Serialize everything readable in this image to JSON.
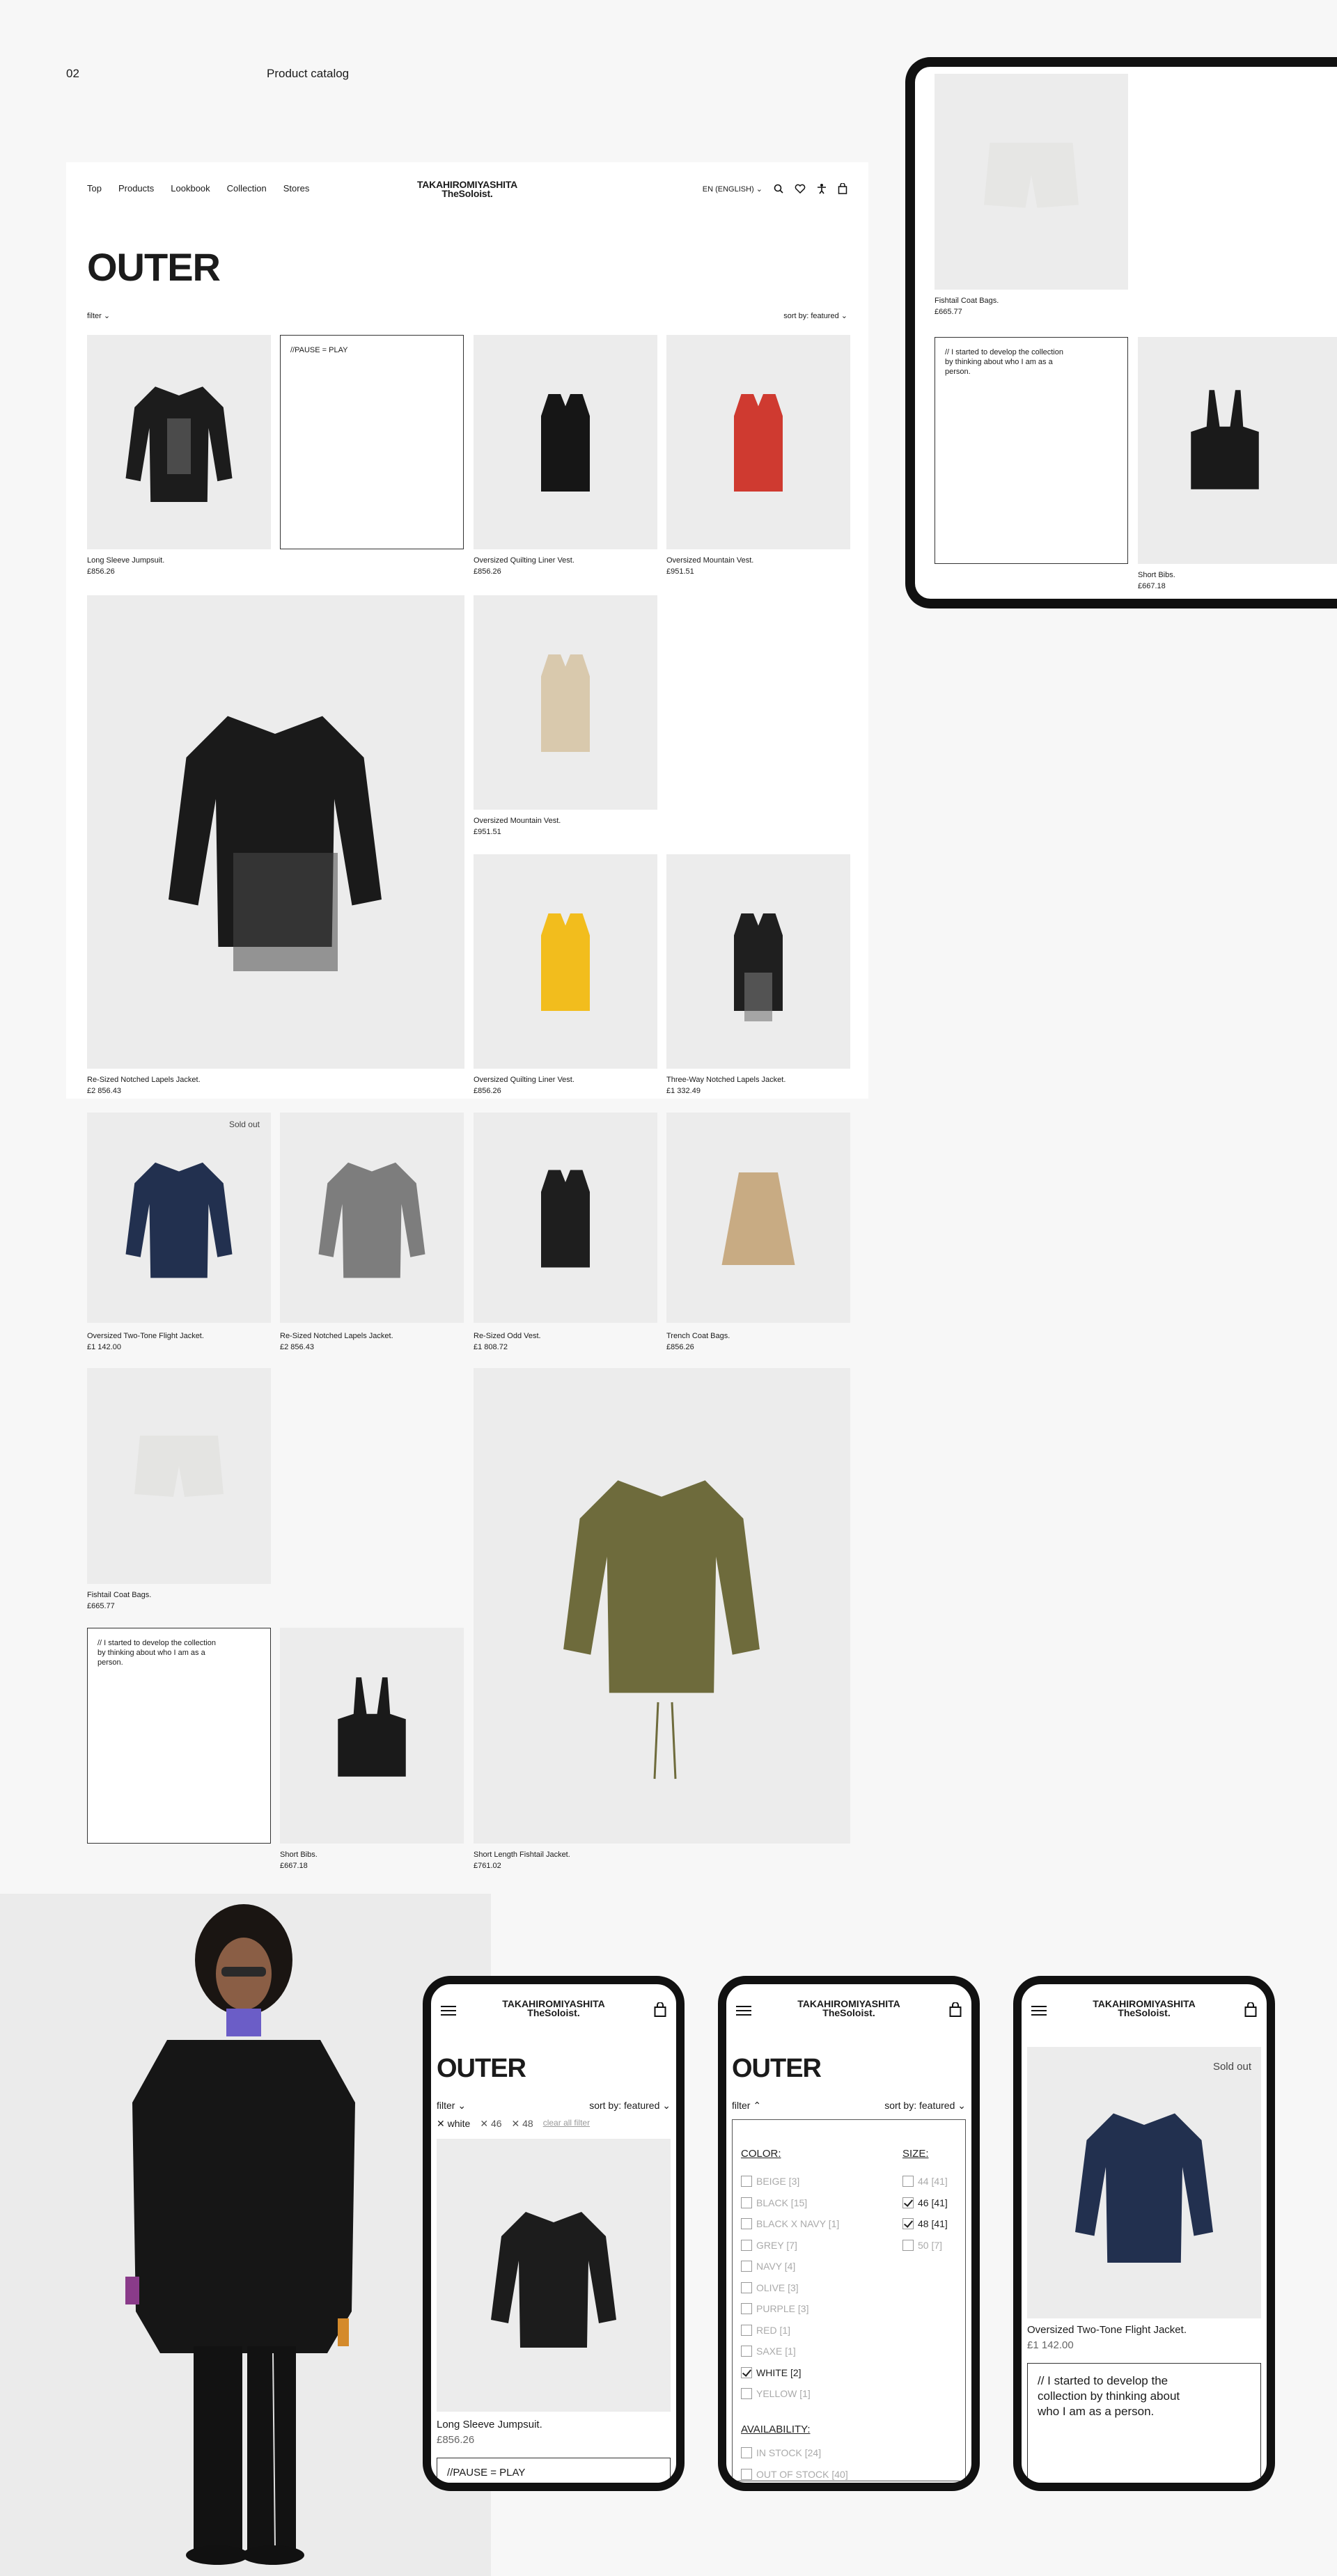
{
  "sheet": {
    "number": "02",
    "title": "Product catalog"
  },
  "nav": {
    "items": [
      "Top",
      "Products",
      "Lookbook",
      "Collection",
      "Stores"
    ],
    "language": "EN (ENGLISH)"
  },
  "brand": {
    "line1": "TAKAHIROMIYASHITA",
    "line2": "TheSoloist."
  },
  "page": {
    "heading": "OUTER",
    "filter": "filter",
    "sort": "sort by: featured"
  },
  "products": [
    {
      "name": "Long Sleeve Jumpsuit.",
      "price": "£856.26"
    },
    {
      "name": "Oversized Quilting Liner Vest.",
      "price": "£856.26"
    },
    {
      "name": "Oversized Mountain Vest.",
      "price": "£951.51"
    },
    {
      "name": "Re-Sized Notched Lapels Jacket.",
      "price": "£2 856.43"
    },
    {
      "name": "Oversized Mountain Vest.",
      "price": "£951.51"
    },
    {
      "name": "Oversized Quilting Liner Vest.",
      "price": "£856.26"
    },
    {
      "name": "Three-Way Notched Lapels Jacket.",
      "price": "£1 332.49"
    },
    {
      "name": "Oversized Two-Tone Flight Jacket.",
      "price": "£1 142.00"
    },
    {
      "name": "Re-Sized Notched Lapels Jacket.",
      "price": "£2 856.43"
    },
    {
      "name": "Re-Sized Odd Vest.",
      "price": "£1 808.72"
    },
    {
      "name": "Trench Coat Bags.",
      "price": "£856.26"
    },
    {
      "name": "Fishtail Coat Bags.",
      "price": "£665.77"
    },
    {
      "name": "Short Bibs.",
      "price": "£667.18"
    },
    {
      "name": "Short Length Fishtail Jacket.",
      "price": "£761.02"
    }
  ],
  "editorial": {
    "pause": "//PAUSE = PLAY",
    "quote": "// I started to develop the collection by thinking about who I am as a person.",
    "quote_mobile": "// I started to develop the collection by thinking about who I am as a person."
  },
  "sold_out": "Sold out",
  "mobile": {
    "filter": "filter",
    "chips": [
      "white",
      "46",
      "48"
    ],
    "clear": "clear all filter",
    "product": {
      "name": "Long Sleeve Jumpsuit.",
      "price": "£856.26"
    },
    "flight": {
      "name": "Oversized Two-Tone Flight Jacket.",
      "price": "£1 142.00"
    },
    "color_title": "COLOR:",
    "size_title": "SIZE:",
    "availability_title": "AVAILABILITY:",
    "colors": [
      {
        "label": "BEIGE [3]",
        "checked": false
      },
      {
        "label": "BLACK [15]",
        "checked": false
      },
      {
        "label": "BLACK X NAVY [1]",
        "checked": false
      },
      {
        "label": "GREY [7]",
        "checked": false
      },
      {
        "label": "NAVY [4]",
        "checked": false
      },
      {
        "label": "OLIVE [3]",
        "checked": false
      },
      {
        "label": "PURPLE [3]",
        "checked": false
      },
      {
        "label": "RED [1]",
        "checked": false
      },
      {
        "label": "SAXE [1]",
        "checked": false
      },
      {
        "label": "WHITE [2]",
        "checked": true
      },
      {
        "label": "YELLOW [1]",
        "checked": false
      }
    ],
    "sizes": [
      {
        "label": "44 [41]",
        "checked": false
      },
      {
        "label": "46 [41]",
        "checked": true
      },
      {
        "label": "48 [41]",
        "checked": true
      },
      {
        "label": "50 [7]",
        "checked": false
      }
    ],
    "availability": [
      {
        "label": "IN STOCK [24]",
        "checked": false
      },
      {
        "label": "OUT OF STOCK [40]",
        "checked": false
      }
    ]
  }
}
